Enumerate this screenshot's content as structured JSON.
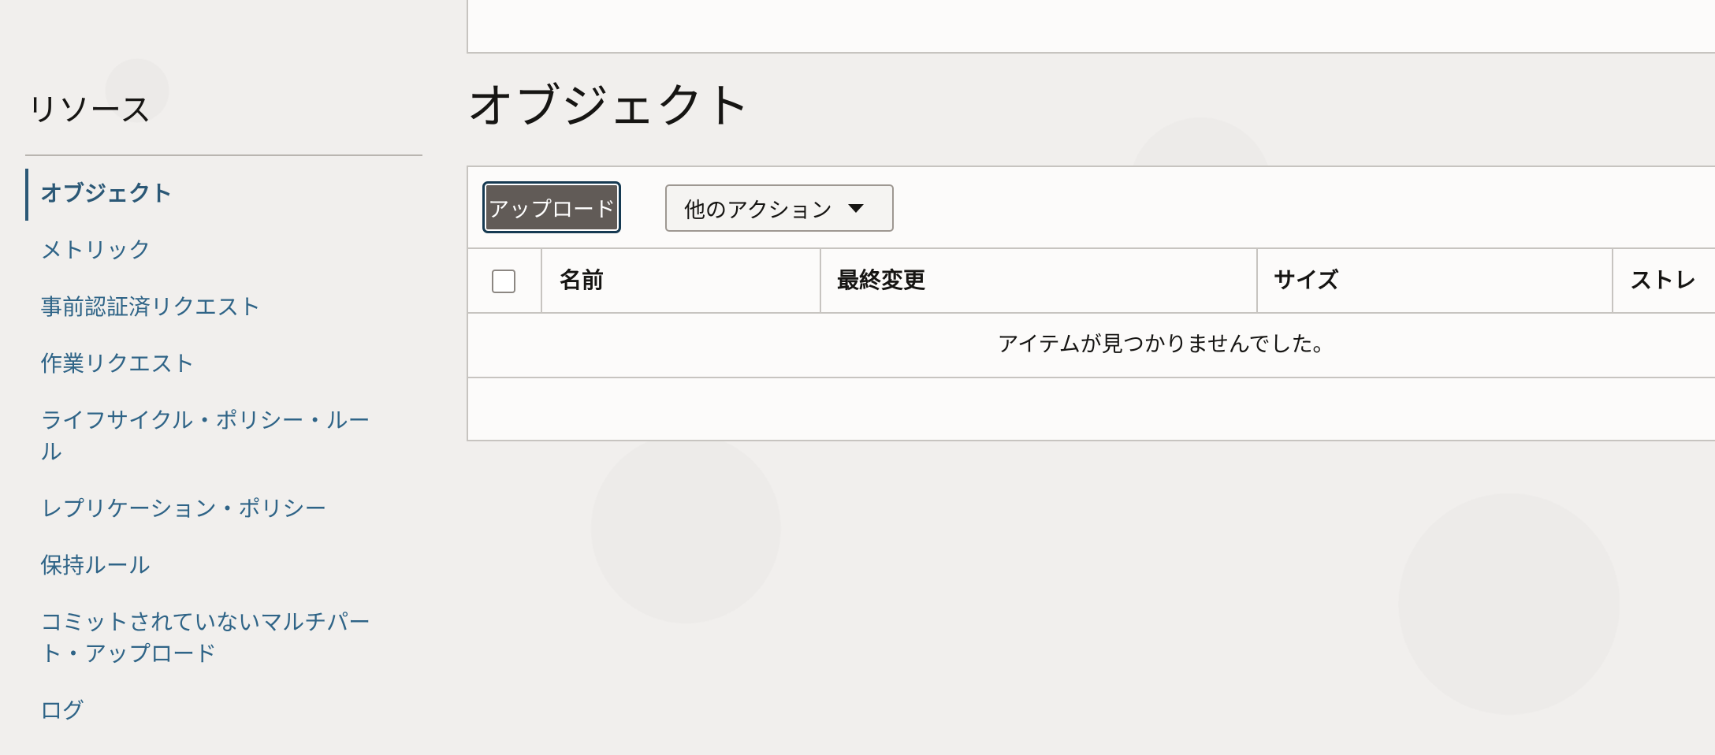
{
  "sidebar": {
    "title": "リソース",
    "items": [
      {
        "label": "オブジェクト"
      },
      {
        "label": "メトリック"
      },
      {
        "label": "事前認証済リクエスト"
      },
      {
        "label": "作業リクエスト"
      },
      {
        "label": "ライフサイクル・ポリシー・ルール"
      },
      {
        "label": "レプリケーション・ポリシー"
      },
      {
        "label": "保持ルール"
      },
      {
        "label": "コミットされていないマルチパート・アップロード"
      },
      {
        "label": "ログ"
      }
    ]
  },
  "main": {
    "title": "オブジェクト",
    "toolbar": {
      "upload_label": "アップロード",
      "more_actions_label": "他のアクション"
    },
    "table": {
      "columns": [
        "名前",
        "最終変更",
        "サイズ",
        "ストレ"
      ],
      "empty_message": "アイテムが見つかりませんでした。"
    }
  },
  "colors": {
    "accent": "#2b5876",
    "link": "#2f6487",
    "primary_button": "#615b57",
    "background": "#f1efed"
  }
}
